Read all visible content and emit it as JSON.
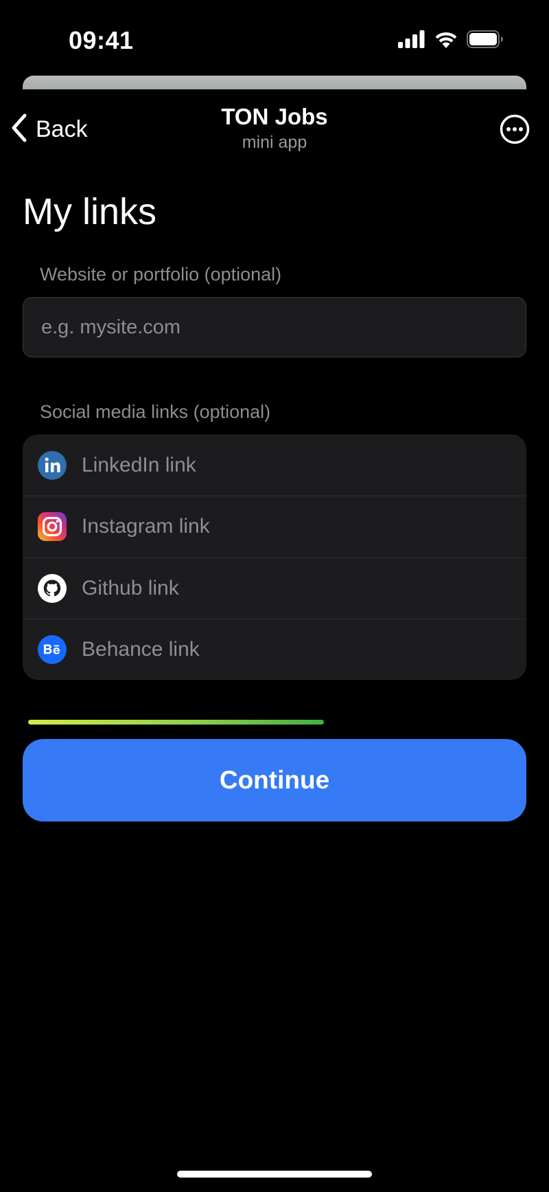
{
  "status_bar": {
    "time": "09:41",
    "signal_icon": "cellular-signal-icon",
    "wifi_icon": "wifi-icon",
    "battery_icon": "battery-icon"
  },
  "nav": {
    "back_label": "Back",
    "back_icon": "chevron-left-icon",
    "title": "TON Jobs",
    "subtitle": "mini app",
    "more_icon": "more-circle-icon"
  },
  "page": {
    "title": "My links"
  },
  "website": {
    "label": "Website or portfolio (optional)",
    "placeholder": "e.g. mysite.com",
    "value": ""
  },
  "social": {
    "label": "Social media links (optional)",
    "items": [
      {
        "icon": "linkedin-icon",
        "placeholder": "LinkedIn link",
        "color": "#2867B2"
      },
      {
        "icon": "instagram-icon",
        "placeholder": "Instagram link",
        "color": "#E1306C"
      },
      {
        "icon": "github-icon",
        "placeholder": "Github link",
        "color": "#FFFFFF"
      },
      {
        "icon": "behance-icon",
        "placeholder": "Behance link",
        "color": "#1769FF"
      }
    ]
  },
  "progress": {
    "fraction": 0.6
  },
  "continue_button": {
    "label": "Continue",
    "color": "#367AF5"
  },
  "colors": {
    "background": "#000000",
    "card": "#1C1C1E",
    "muted_text": "#8E8E93",
    "accent": "#367AF5"
  }
}
